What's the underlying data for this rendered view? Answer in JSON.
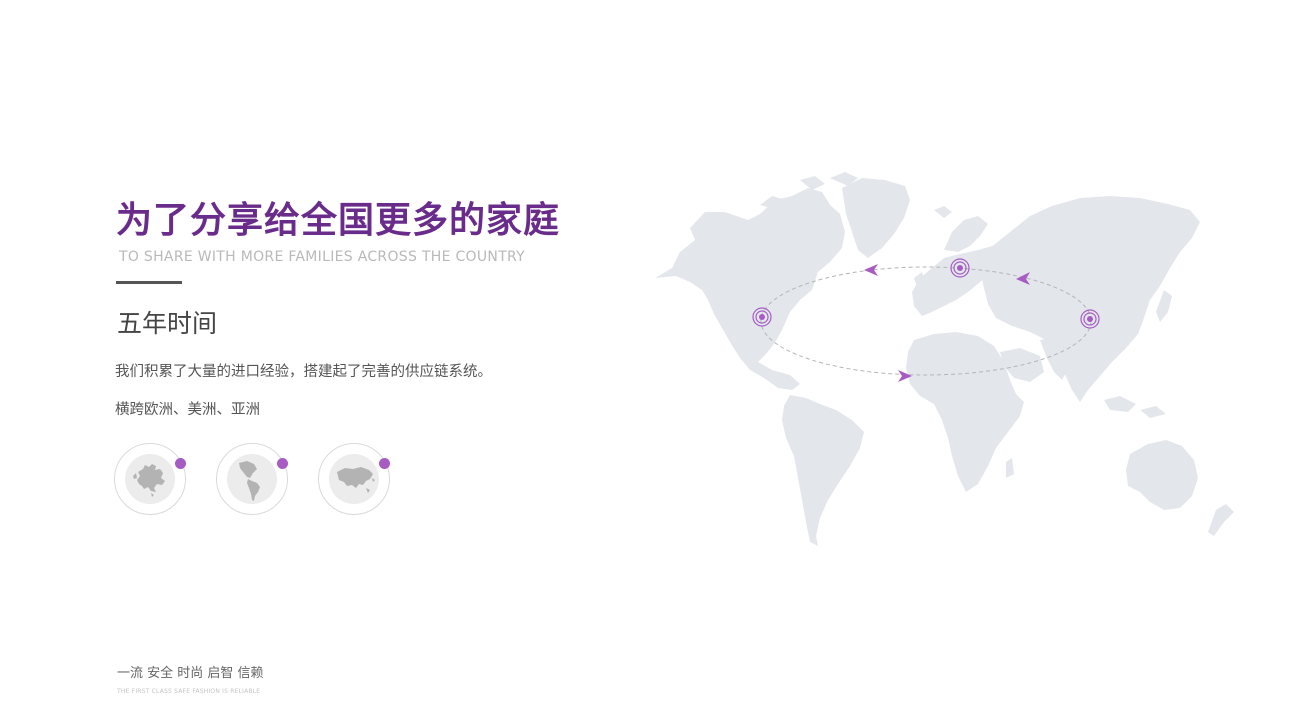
{
  "headline": {
    "title_cn": "为了分享给全国更多的家庭",
    "title_en": "TO SHARE WITH MORE FAMILIES ACROSS THE COUNTRY"
  },
  "section": {
    "subtitle": "五年时间",
    "description": "我们积累了大量的进口经验，搭建起了完善的供应链系统。",
    "regions": "横跨欧洲、美洲、亚洲"
  },
  "continents": [
    {
      "icon": "europe-map-icon"
    },
    {
      "icon": "americas-map-icon"
    },
    {
      "icon": "asia-map-icon"
    }
  ],
  "footer": {
    "slogan_cn": "一流 安全 时尚 启智 信赖",
    "slogan_en": "THE FIRST CLASS SAFE FASHION IS RELIABLE"
  },
  "colors": {
    "accent_purple": "#6a2c8a",
    "marker_purple": "#a75cc4",
    "map_gray": "#e3e7ec",
    "text_gray": "#555555"
  }
}
